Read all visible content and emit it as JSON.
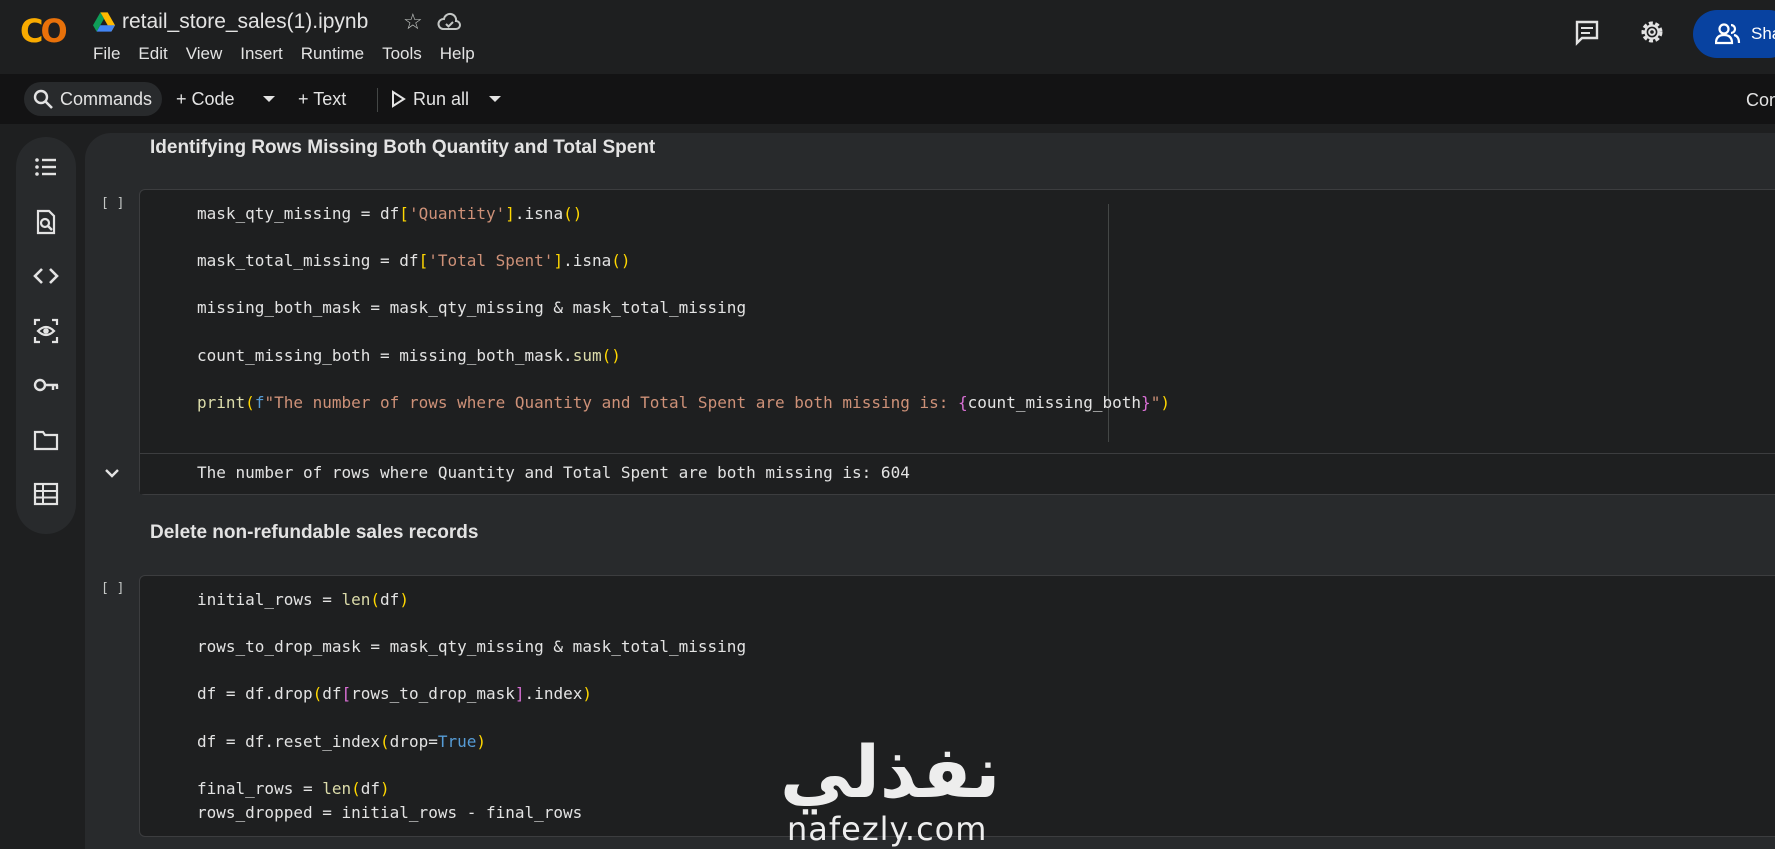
{
  "app": {
    "logo": "CO",
    "filename": "retail_store_sales(1).ipynb",
    "menu": [
      "File",
      "Edit",
      "View",
      "Insert",
      "Runtime",
      "Tools",
      "Help"
    ],
    "share_label": "Sha",
    "icons": [
      "drive-icon",
      "star-icon",
      "cloud-saved-icon",
      "comment-icon",
      "settings-icon",
      "people-icon"
    ]
  },
  "toolbar": {
    "commands_label": "Commands",
    "code_label": "+ Code",
    "text_label": "+ Text",
    "run_all_label": "Run all",
    "connect_label": "Con"
  },
  "sidebar": {
    "icons": [
      "table-of-contents-icon",
      "find-replace-icon",
      "code-snippets-icon",
      "variables-icon",
      "secrets-key-icon",
      "files-folder-icon",
      "data-table-icon"
    ]
  },
  "notebook": {
    "heading1": "Identifying Rows Missing Both Quantity and Total Spent",
    "heading2": "Delete non-refundable sales records",
    "cell1": {
      "bracket": "[ ]",
      "output": "The number of rows where Quantity and Total Spent are both missing is: 604"
    },
    "cell2": {
      "bracket": "[ ]"
    }
  },
  "watermark": {
    "arabic": "نفذلي",
    "latin": "nafezly.com"
  }
}
